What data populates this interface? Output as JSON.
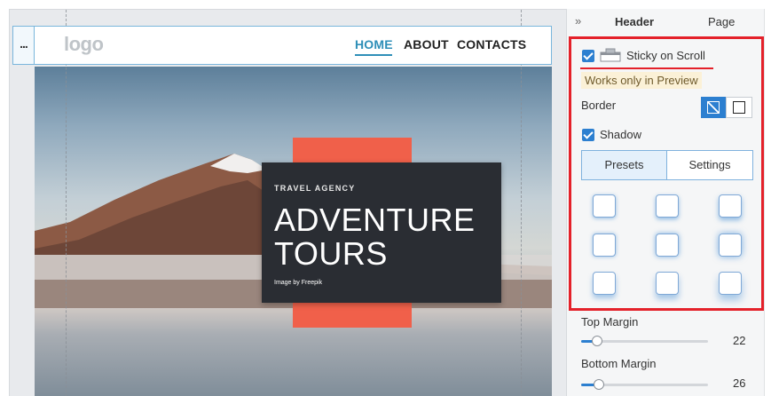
{
  "header_bar": {
    "menu_glyph": "...",
    "logo": "logo",
    "nav": {
      "home": "HOME",
      "about": "ABOUT",
      "contacts": "CONTACTS"
    }
  },
  "hero": {
    "kicker": "TRAVEL AGENCY",
    "title_line1": "ADVENTURE",
    "title_line2": "TOURS",
    "credit": "Image by Freepik"
  },
  "panel": {
    "collapse_glyph": "»",
    "tabs": {
      "header": "Header",
      "page": "Page"
    },
    "sticky": {
      "label": "Sticky on Scroll",
      "checked": true,
      "note": "Works only in Preview"
    },
    "border": {
      "label": "Border",
      "options": [
        "none",
        "solid"
      ],
      "selected": "none"
    },
    "shadow": {
      "label": "Shadow",
      "checked": true,
      "tabs": {
        "presets": "Presets",
        "settings": "Settings"
      },
      "active_tab": "Presets"
    },
    "top_margin": {
      "label": "Top Margin",
      "value": "22"
    },
    "bottom_margin": {
      "label": "Bottom Margin",
      "value": "26"
    }
  },
  "colors": {
    "accent": "#2c7fd0",
    "nav_active": "#2f8fb8",
    "highlight": "#e4212a",
    "hero_orange": "#f0604a",
    "promo_bg": "#2a2d33"
  }
}
